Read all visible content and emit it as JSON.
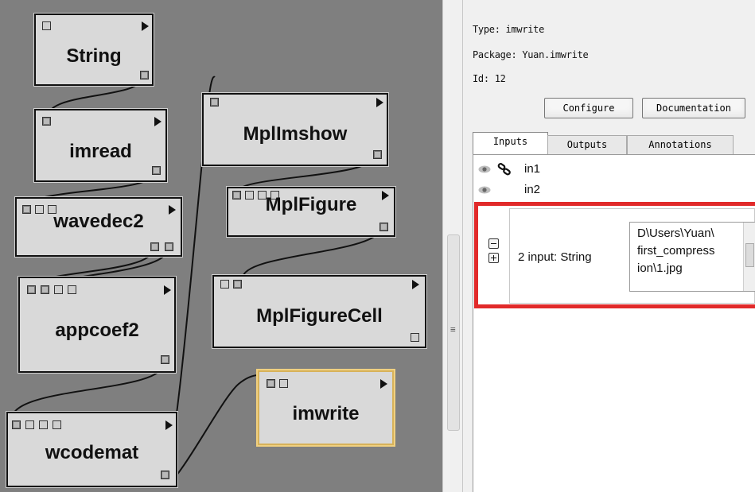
{
  "canvas": {
    "modules": [
      {
        "id": "string",
        "title": "String"
      },
      {
        "id": "imread",
        "title": "imread"
      },
      {
        "id": "wavedec2",
        "title": "wavedec2"
      },
      {
        "id": "appcoef2",
        "title": "appcoef2"
      },
      {
        "id": "wcodemat",
        "title": "wcodemat"
      },
      {
        "id": "mplimshow",
        "title": "MplImshow"
      },
      {
        "id": "mplfigure",
        "title": "MplFigure"
      },
      {
        "id": "mplfigurecell",
        "title": "MplFigureCell"
      },
      {
        "id": "imwrite",
        "title": "imwrite"
      }
    ]
  },
  "panel": {
    "type_line": "Type: imwrite",
    "package_line": "Package: Yuan.imwrite",
    "id_line": "Id: 12",
    "configure_label": "Configure",
    "documentation_label": "Documentation",
    "tabs": [
      {
        "label": "Inputs",
        "active": true
      },
      {
        "label": "Outputs",
        "active": false
      },
      {
        "label": "Annotations",
        "active": false
      }
    ],
    "ports": [
      {
        "name": "in1",
        "connected": true
      },
      {
        "name": "in2",
        "connected": false
      }
    ],
    "editor": {
      "label": "2 input: String",
      "value_lines": [
        "D\\Users\\Yuan\\",
        "first_compress",
        "ion\\1.jpg"
      ]
    }
  },
  "icons": {
    "visibility": "eye-icon",
    "connection": "chain-link-icon",
    "remove": "minus-icon",
    "add": "plus-icon"
  },
  "colors": {
    "canvas_bg": "#7f7f7f",
    "module_bg": "#d9d9d9",
    "selected_border": "#d7b25a",
    "highlight": "#e12a2a"
  }
}
